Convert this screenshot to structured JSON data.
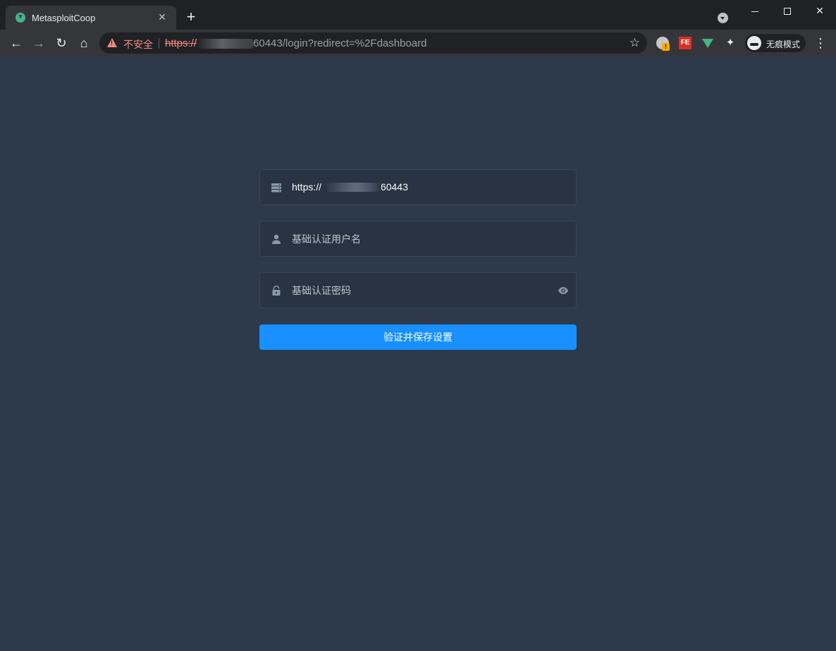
{
  "browser": {
    "tab_title": "MetasploitCoop",
    "tab_close": "✕",
    "new_tab": "+",
    "security_label": "不安全",
    "url_scheme": "https://",
    "url_rest": "60443/login?redirect=%2Fdashboard",
    "incognito_label": "无痕模式",
    "ext_fe_label": "FE"
  },
  "form": {
    "server_value": "https://",
    "server_suffix": ".60443",
    "username_placeholder": "基础认证用户名",
    "password_placeholder": "基础认证密码",
    "submit_label": "验证并保存设置"
  },
  "colors": {
    "page_bg": "#2d3a4b",
    "input_bg": "#283443",
    "primary": "#1890ff",
    "insecure": "#f28b82"
  },
  "icons": {
    "server": "server-icon",
    "user": "user-icon",
    "lock": "lock-icon",
    "eye": "eye-icon"
  }
}
